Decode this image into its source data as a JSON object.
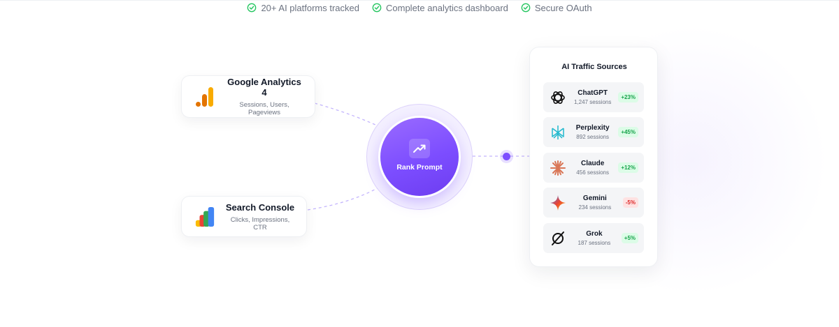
{
  "features": [
    {
      "icon": "check-circle-icon",
      "label": "20+ AI platforms tracked"
    },
    {
      "icon": "check-circle-icon",
      "label": "Complete analytics dashboard"
    },
    {
      "icon": "check-circle-icon",
      "label": "Secure OAuth"
    }
  ],
  "sources": {
    "ga4": {
      "title": "Google Analytics 4",
      "subtitle": "Sessions, Users, Pageviews",
      "icon": "google-analytics-icon"
    },
    "gsc": {
      "title": "Search Console",
      "subtitle": "Clicks, Impressions, CTR",
      "icon": "search-console-icon"
    }
  },
  "hub": {
    "label": "Rank Prompt",
    "icon": "trending-up-icon"
  },
  "panel": {
    "title": "AI Traffic Sources",
    "items": [
      {
        "name": "ChatGPT",
        "sessions": "1,247 sessions",
        "change": "+23%",
        "trend": "up",
        "icon": "chatgpt-icon"
      },
      {
        "name": "Perplexity",
        "sessions": "892 sessions",
        "change": "+45%",
        "trend": "up",
        "icon": "perplexity-icon"
      },
      {
        "name": "Claude",
        "sessions": "456 sessions",
        "change": "+12%",
        "trend": "up",
        "icon": "claude-icon"
      },
      {
        "name": "Gemini",
        "sessions": "234 sessions",
        "change": "-5%",
        "trend": "down",
        "icon": "gemini-icon"
      },
      {
        "name": "Grok",
        "sessions": "187 sessions",
        "change": "+5%",
        "trend": "up",
        "icon": "grok-icon"
      }
    ]
  },
  "colors": {
    "accent": "#7c4dff",
    "check": "#22c55e",
    "up": "#16a34a",
    "down": "#dc2626"
  }
}
